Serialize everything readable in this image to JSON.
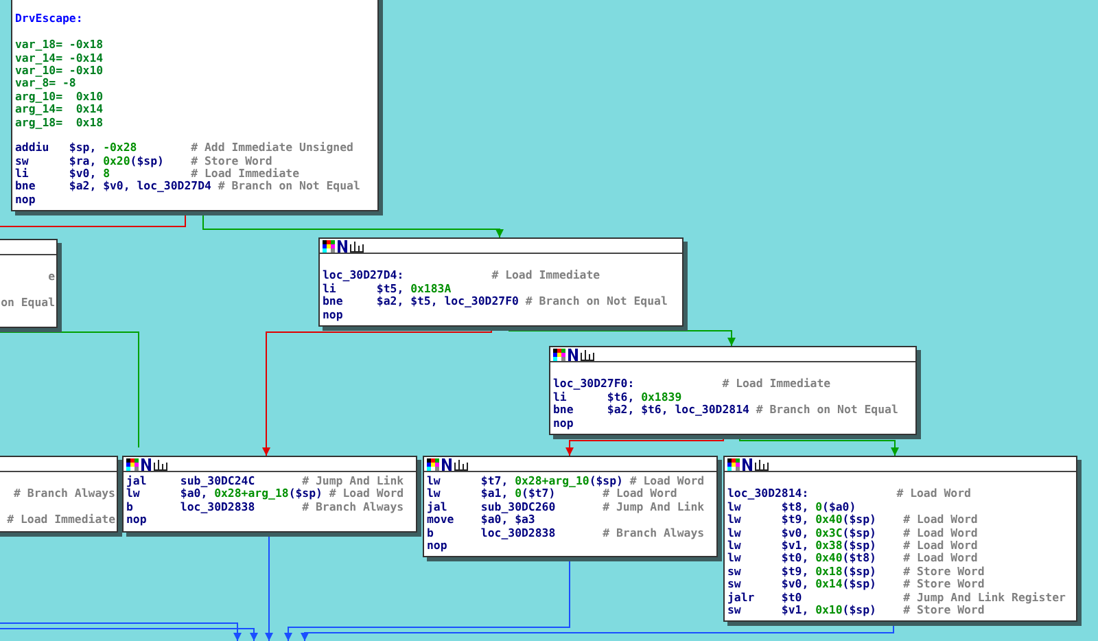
{
  "blocks": [
    {
      "header": false,
      "lines": [
        {
          "kind": "gap"
        },
        {
          "kind": "name",
          "text": "DrvEscape:"
        },
        {
          "kind": "gap"
        },
        {
          "kind": "var",
          "text": "var_18= -0x18"
        },
        {
          "kind": "var",
          "text": "var_14= -0x14"
        },
        {
          "kind": "var",
          "text": "var_10= -0x10"
        },
        {
          "kind": "var",
          "text": "var_8= -8"
        },
        {
          "kind": "var",
          "text": "arg_10=  0x10"
        },
        {
          "kind": "var",
          "text": "arg_14=  0x14"
        },
        {
          "kind": "var",
          "text": "arg_18=  0x18"
        },
        {
          "kind": "gap"
        },
        {
          "kind": "insn",
          "mnemonic": "addiu",
          "operands": [
            {
              "t": "$sp, ",
              "kind": "reg"
            },
            {
              "t": "-0x28",
              "kind": "num"
            }
          ],
          "comment": "# Add Immediate Unsigned"
        },
        {
          "kind": "insn",
          "mnemonic": "sw",
          "operands": [
            {
              "t": "$ra, ",
              "kind": "reg"
            },
            {
              "t": "0x20",
              "kind": "num"
            },
            {
              "t": "($sp)",
              "kind": "reg"
            }
          ],
          "comment": "# Store Word"
        },
        {
          "kind": "insn",
          "mnemonic": "li",
          "operands": [
            {
              "t": "$v0, ",
              "kind": "reg"
            },
            {
              "t": "8",
              "kind": "num"
            }
          ],
          "comment": "# Load Immediate"
        },
        {
          "kind": "insn",
          "mnemonic": "bne",
          "operands": [
            {
              "t": "$a2, $v0, loc_30D27D4",
              "kind": "reg"
            }
          ],
          "comment": "# Branch on Not Equal"
        },
        {
          "kind": "insn",
          "mnemonic": "nop"
        }
      ]
    },
    {
      "header": true,
      "lines": [
        {
          "kind": "gap"
        },
        {
          "kind": "tail",
          "text": "e"
        },
        {
          "kind": "gap"
        },
        {
          "kind": "tail",
          "text": "on Equal"
        },
        {
          "kind": "gap"
        }
      ]
    },
    {
      "header": true,
      "lines": [
        {
          "kind": "gap"
        },
        {
          "kind": "label",
          "text": "loc_30D27D4:",
          "comment": "# Load Immediate"
        },
        {
          "kind": "insn",
          "mnemonic": "li",
          "operands": [
            {
              "t": "$t5, ",
              "kind": "reg"
            },
            {
              "t": "0x183A",
              "kind": "num"
            }
          ]
        },
        {
          "kind": "insn",
          "mnemonic": "bne",
          "operands": [
            {
              "t": "$a2, $t5, loc_30D27F0",
              "kind": "reg"
            }
          ],
          "comment": "# Branch on Not Equal"
        },
        {
          "kind": "insn",
          "mnemonic": "nop"
        }
      ]
    },
    {
      "header": true,
      "lines": [
        {
          "kind": "gap"
        },
        {
          "kind": "label",
          "text": "loc_30D27F0:",
          "comment": "# Load Immediate"
        },
        {
          "kind": "insn",
          "mnemonic": "li",
          "operands": [
            {
              "t": "$t6, ",
              "kind": "reg"
            },
            {
              "t": "0x1839",
              "kind": "num"
            }
          ]
        },
        {
          "kind": "insn",
          "mnemonic": "bne",
          "operands": [
            {
              "t": "$a2, $t6, loc_30D2814",
              "kind": "reg"
            }
          ],
          "comment": "# Branch on Not Equal"
        },
        {
          "kind": "insn",
          "mnemonic": "nop"
        }
      ]
    },
    {
      "header": true,
      "lines": [
        {
          "kind": "gap"
        },
        {
          "kind": "tail",
          "text": "# Branch Always"
        },
        {
          "kind": "gap"
        },
        {
          "kind": "tail",
          "text": "# Load Immediate"
        }
      ]
    },
    {
      "header": true,
      "lines": [
        {
          "kind": "insn",
          "mnemonic": "jal",
          "operands": [
            {
              "t": "sub_30DC24C",
              "kind": "reg"
            }
          ],
          "comment": "# Jump And Link"
        },
        {
          "kind": "insn",
          "mnemonic": "lw",
          "operands": [
            {
              "t": "$a0, ",
              "kind": "reg"
            },
            {
              "t": "0x28+arg_18",
              "kind": "num"
            },
            {
              "t": "($sp)",
              "kind": "reg"
            }
          ],
          "comment": "# Load Word"
        },
        {
          "kind": "insn",
          "mnemonic": "b",
          "operands": [
            {
              "t": "loc_30D2838",
              "kind": "reg"
            }
          ],
          "comment": "# Branch Always"
        },
        {
          "kind": "insn",
          "mnemonic": "nop"
        }
      ]
    },
    {
      "header": true,
      "lines": [
        {
          "kind": "insn",
          "mnemonic": "lw",
          "operands": [
            {
              "t": "$t7, ",
              "kind": "reg"
            },
            {
              "t": "0x28+arg_10",
              "kind": "num"
            },
            {
              "t": "($sp)",
              "kind": "reg"
            }
          ],
          "comment": "# Load Word"
        },
        {
          "kind": "insn",
          "mnemonic": "lw",
          "operands": [
            {
              "t": "$a1, ",
              "kind": "reg"
            },
            {
              "t": "0",
              "kind": "num"
            },
            {
              "t": "($t7)",
              "kind": "reg"
            }
          ],
          "comment": "# Load Word"
        },
        {
          "kind": "insn",
          "mnemonic": "jal",
          "operands": [
            {
              "t": "sub_30DC260",
              "kind": "reg"
            }
          ],
          "comment": "# Jump And Link"
        },
        {
          "kind": "insn",
          "mnemonic": "move",
          "operands": [
            {
              "t": "$a0, $a3",
              "kind": "reg"
            }
          ]
        },
        {
          "kind": "insn",
          "mnemonic": "b",
          "operands": [
            {
              "t": "loc_30D2838",
              "kind": "reg"
            }
          ],
          "comment": "# Branch Always"
        },
        {
          "kind": "insn",
          "mnemonic": "nop"
        }
      ]
    },
    {
      "header": true,
      "lines": [
        {
          "kind": "gap"
        },
        {
          "kind": "label",
          "text": "loc_30D2814:",
          "comment": "# Load Word"
        },
        {
          "kind": "insn",
          "mnemonic": "lw",
          "operands": [
            {
              "t": "$t8, ",
              "kind": "reg"
            },
            {
              "t": "0",
              "kind": "num"
            },
            {
              "t": "($a0)",
              "kind": "reg"
            }
          ]
        },
        {
          "kind": "insn",
          "mnemonic": "lw",
          "operands": [
            {
              "t": "$t9, ",
              "kind": "reg"
            },
            {
              "t": "0x40",
              "kind": "num"
            },
            {
              "t": "($sp)",
              "kind": "reg"
            }
          ],
          "comment": "# Load Word"
        },
        {
          "kind": "insn",
          "mnemonic": "lw",
          "operands": [
            {
              "t": "$v0, ",
              "kind": "reg"
            },
            {
              "t": "0x3C",
              "kind": "num"
            },
            {
              "t": "($sp)",
              "kind": "reg"
            }
          ],
          "comment": "# Load Word"
        },
        {
          "kind": "insn",
          "mnemonic": "lw",
          "operands": [
            {
              "t": "$v1, ",
              "kind": "reg"
            },
            {
              "t": "0x38",
              "kind": "num"
            },
            {
              "t": "($sp)",
              "kind": "reg"
            }
          ],
          "comment": "# Load Word"
        },
        {
          "kind": "insn",
          "mnemonic": "lw",
          "operands": [
            {
              "t": "$t0, ",
              "kind": "reg"
            },
            {
              "t": "0x40",
              "kind": "num"
            },
            {
              "t": "($t8)",
              "kind": "reg"
            }
          ],
          "comment": "# Load Word"
        },
        {
          "kind": "insn",
          "mnemonic": "sw",
          "operands": [
            {
              "t": "$t9, ",
              "kind": "reg"
            },
            {
              "t": "0x18",
              "kind": "num"
            },
            {
              "t": "($sp)",
              "kind": "reg"
            }
          ],
          "comment": "# Store Word"
        },
        {
          "kind": "insn",
          "mnemonic": "sw",
          "operands": [
            {
              "t": "$v0, ",
              "kind": "reg"
            },
            {
              "t": "0x14",
              "kind": "num"
            },
            {
              "t": "($sp)",
              "kind": "reg"
            }
          ],
          "comment": "# Store Word"
        },
        {
          "kind": "insn",
          "mnemonic": "jalr",
          "operands": [
            {
              "t": "$t0",
              "kind": "reg"
            }
          ],
          "comment": "# Jump And Link Register"
        },
        {
          "kind": "insn",
          "mnemonic": "sw",
          "operands": [
            {
              "t": "$v1, ",
              "kind": "reg"
            },
            {
              "t": "0x10",
              "kind": "num"
            },
            {
              "t": "($sp)",
              "kind": "reg"
            }
          ],
          "comment": "# Store Word"
        }
      ]
    }
  ],
  "edges": [
    {
      "kind": "false"
    },
    {
      "kind": "true"
    },
    {
      "kind": "true"
    },
    {
      "kind": "false"
    },
    {
      "kind": "true"
    },
    {
      "kind": "false"
    },
    {
      "kind": "true"
    },
    {
      "kind": "jump"
    },
    {
      "kind": "jump"
    },
    {
      "kind": "jump"
    },
    {
      "kind": "jump"
    },
    {
      "kind": "jump"
    }
  ]
}
